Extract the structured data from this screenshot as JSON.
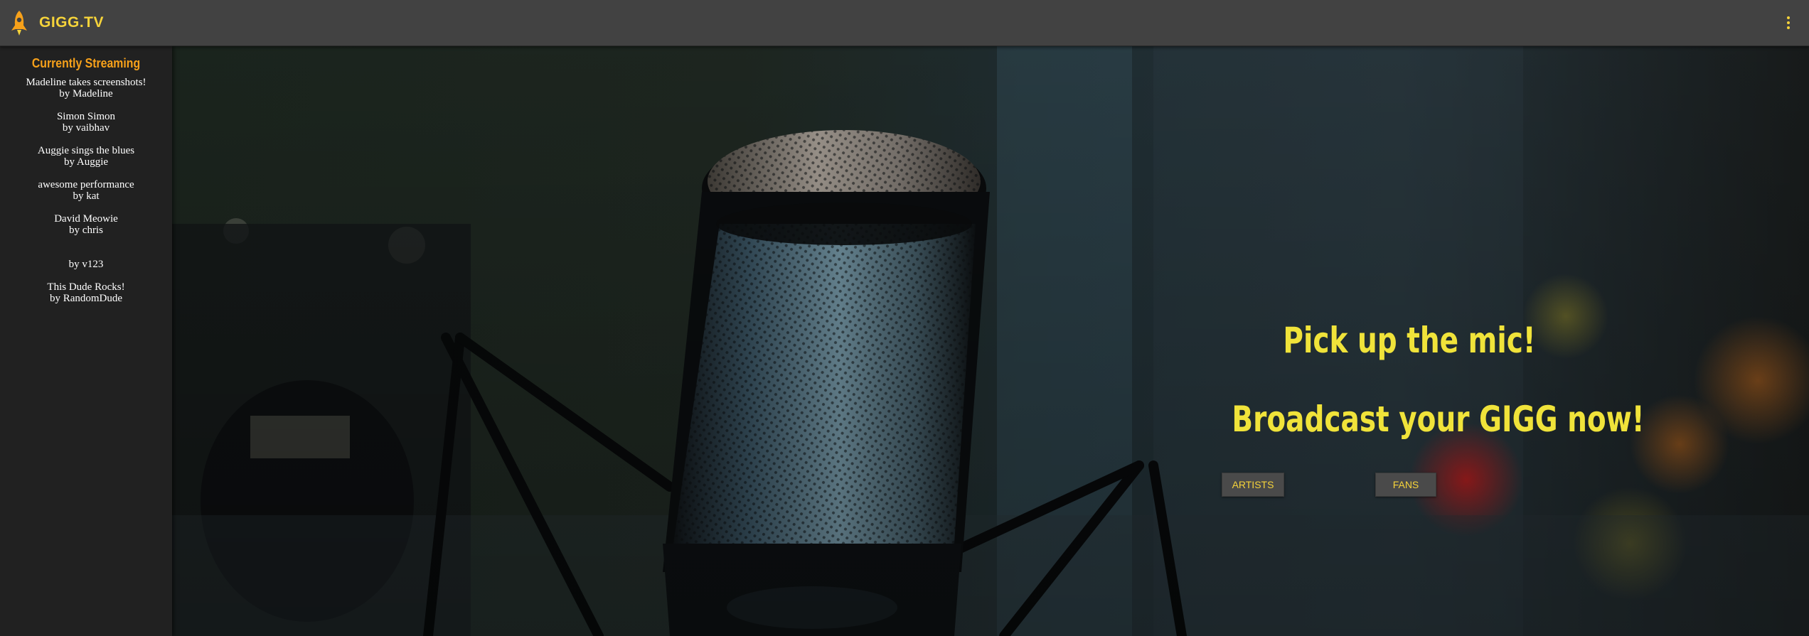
{
  "header": {
    "brand": "GIGG.TV",
    "logo_icon": "rocket-icon",
    "menu_icon": "more-vert-icon"
  },
  "sidebar": {
    "title": "Currently Streaming",
    "streams": [
      {
        "title": "Madeline takes screenshots!",
        "author": "by Madeline"
      },
      {
        "title": "Simon Simon",
        "author": "by vaibhav"
      },
      {
        "title": "Auggie sings the blues",
        "author": "by Auggie"
      },
      {
        "title": "awesome performance",
        "author": "by kat"
      },
      {
        "title": "David Meowie",
        "author": "by chris"
      },
      {
        "title": "",
        "author": "by v123"
      },
      {
        "title": "This Dude Rocks!",
        "author": "by RandomDude"
      }
    ]
  },
  "hero": {
    "line1": "Pick up the mic!",
    "line2": "Broadcast your GIGG now!",
    "artists_label": "ARTISTS",
    "fans_label": "FANS"
  },
  "colors": {
    "accent_yellow": "#f5d33a",
    "sidebar_title": "#f7a11a",
    "topbar": "#424242",
    "sidebar": "#212121"
  }
}
